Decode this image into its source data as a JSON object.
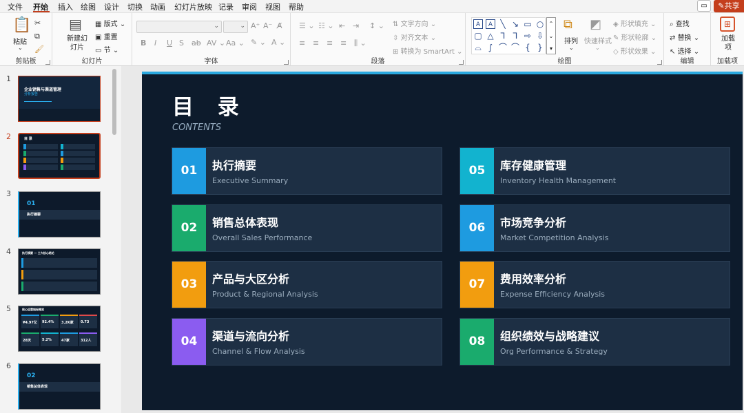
{
  "menu": {
    "items": [
      "文件",
      "开始",
      "插入",
      "绘图",
      "设计",
      "切换",
      "动画",
      "幻灯片放映",
      "记录",
      "审阅",
      "视图",
      "帮助"
    ],
    "active": "开始",
    "share_label": "共享"
  },
  "ribbon": {
    "clipboard": {
      "label": "剪贴板",
      "paste": "粘贴"
    },
    "slides": {
      "label": "幻灯片",
      "new_slide": "新建幻灯片",
      "layout": "版式",
      "reset": "重置",
      "section": "节"
    },
    "font": {
      "label": "字体"
    },
    "paragraph": {
      "label": "段落",
      "text_direction": "文字方向",
      "align_text": "对齐文本",
      "smartart": "转换为 SmartArt"
    },
    "drawing": {
      "label": "绘图",
      "arrange": "排列",
      "quick_styles": "快速样式",
      "shape_fill": "形状填充",
      "shape_outline": "形状轮廓",
      "shape_effects": "形状效果"
    },
    "editing": {
      "label": "编辑",
      "find": "查找",
      "replace": "替换",
      "select": "选择"
    },
    "addins": {
      "label": "加载项",
      "button": "加载项"
    }
  },
  "thumbnails": [
    {
      "num": "1",
      "title": "企业销售与渠道管理",
      "subtitle": "分析报告"
    },
    {
      "num": "2",
      "title": "目 录"
    },
    {
      "num": "3",
      "badge": "01",
      "title": "执行摘要"
    },
    {
      "num": "4",
      "title": "执行摘要 — 三大核心结论"
    },
    {
      "num": "5",
      "title": "核心运营指标概览",
      "kpis": [
        "¥4.97亿",
        "92.4%",
        "3.2K家",
        "0.73",
        "28天",
        "5.2%",
        "47家",
        "312人"
      ]
    },
    {
      "num": "6",
      "badge": "02",
      "title": "销售总体表现"
    }
  ],
  "slide": {
    "title": "目 录",
    "subtitle": "CONTENTS",
    "items": [
      {
        "num": "01",
        "cn": "执行摘要",
        "en": "Executive Summary",
        "color": "#1e9be0"
      },
      {
        "num": "02",
        "cn": "销售总体表现",
        "en": "Overall Sales Performance",
        "color": "#1aab6d"
      },
      {
        "num": "03",
        "cn": "产品与大区分析",
        "en": "Product & Regional Analysis",
        "color": "#f29d0f"
      },
      {
        "num": "04",
        "cn": "渠道与流向分析",
        "en": "Channel & Flow Analysis",
        "color": "#8b5cf0"
      },
      {
        "num": "05",
        "cn": "库存健康管理",
        "en": "Inventory Health Management",
        "color": "#12b3cf"
      },
      {
        "num": "06",
        "cn": "市场竞争分析",
        "en": "Market Competition Analysis",
        "color": "#1e9be0"
      },
      {
        "num": "07",
        "cn": "费用效率分析",
        "en": "Expense Efficiency Analysis",
        "color": "#f29d0f"
      },
      {
        "num": "08",
        "cn": "组织绩效与战略建议",
        "en": "Org Performance & Strategy",
        "color": "#1aab6d"
      }
    ]
  }
}
